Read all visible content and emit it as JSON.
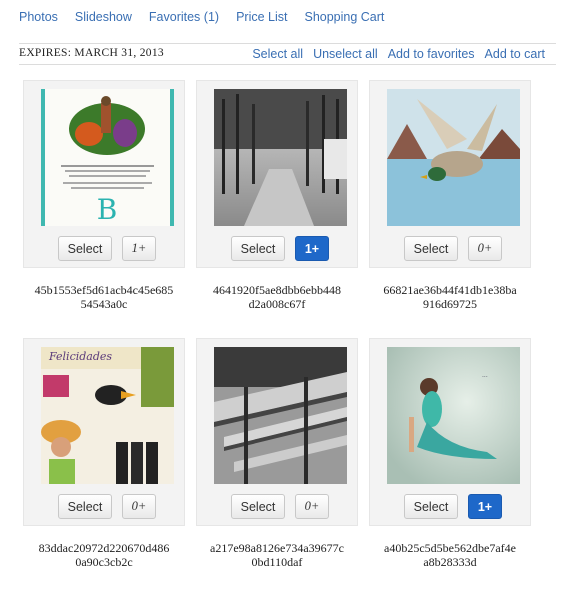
{
  "nav": {
    "photos": "Photos",
    "slideshow": "Slideshow",
    "favorites": "Favorites",
    "favorites_count": "(1)",
    "price_list": "Price List",
    "shopping_cart": "Shopping Cart"
  },
  "toolbar": {
    "expires": "EXPIRES: MARCH 31, 2013",
    "select_all": "Select all",
    "unselect_all": "Unselect all",
    "add_to_favorites": "Add to favorites",
    "add_to_cart": "Add to cart"
  },
  "photos": [
    {
      "select_label": "Select",
      "qty": "1+",
      "active": false,
      "name_line1": "45b1553ef5d61acb4c45e685",
      "name_line2": "54543a0c"
    },
    {
      "select_label": "Select",
      "qty": "1+",
      "active": true,
      "name_line1": "4641920f5ae8dbb6ebb448",
      "name_line2": "d2a008c67f"
    },
    {
      "select_label": "Select",
      "qty": "0+",
      "active": false,
      "name_line1": "66821ae36b44f41db1e38ba",
      "name_line2": "916d69725"
    },
    {
      "select_label": "Select",
      "qty": "0+",
      "active": false,
      "name_line1": "83ddac20972d220670d486",
      "name_line2": "0a90c3cb2c"
    },
    {
      "select_label": "Select",
      "qty": "0+",
      "active": false,
      "name_line1": "a217e98a8126e734a39677c",
      "name_line2": "0bd110daf"
    },
    {
      "select_label": "Select",
      "qty": "1+",
      "active": true,
      "name_line1": "a40b25c5d5be562dbe7af4e",
      "name_line2": "a8b28333d"
    }
  ],
  "colors": {
    "link": "#3a6fb3",
    "active_button": "#1e68c9"
  }
}
